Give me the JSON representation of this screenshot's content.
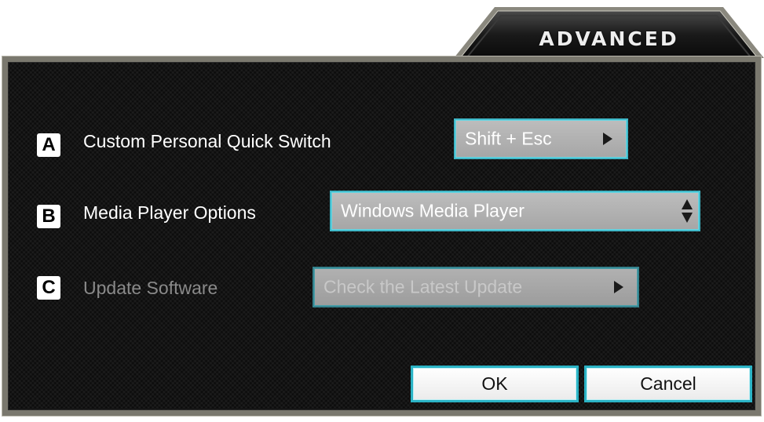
{
  "tab": {
    "label": "ADVANCED"
  },
  "rows": [
    {
      "badge": "A",
      "label": "Custom Personal Quick Switch",
      "control_value": "Shift + Esc",
      "enabled": true
    },
    {
      "badge": "B",
      "label": "Media Player Options",
      "control_value": "Windows Media Player",
      "enabled": true
    },
    {
      "badge": "C",
      "label": "Update Software",
      "control_value": "Check the Latest Update",
      "enabled": false
    }
  ],
  "buttons": {
    "ok": "OK",
    "cancel": "Cancel"
  },
  "colors": {
    "accent": "#3fb8c8",
    "panel_bg": "#0c0c0c",
    "frame": "#7a786e",
    "disabled_text": "#8a8a8a"
  }
}
